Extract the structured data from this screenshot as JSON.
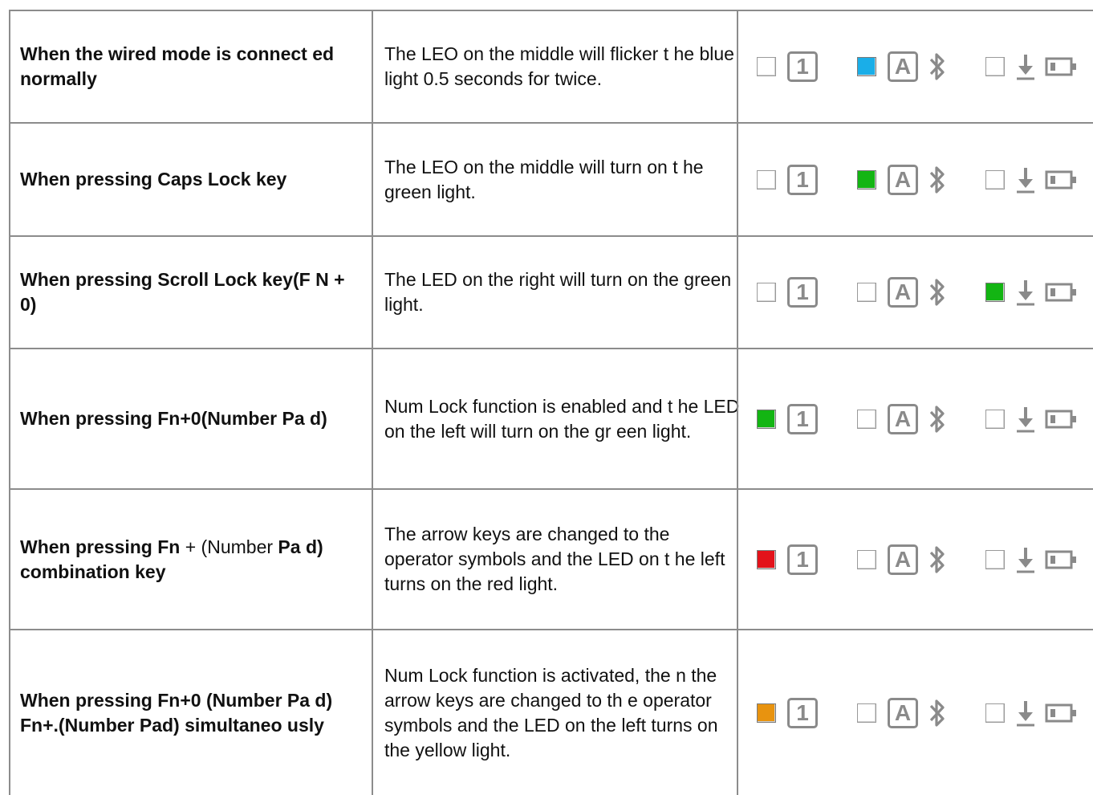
{
  "rows": [
    {
      "condition": "When the wired mode is connect ed normally",
      "description": "The LEO on the middle will flicker t he blue light 0.5 seconds for twice.",
      "leds": {
        "left": "off",
        "middle": "blue",
        "right": "off"
      }
    },
    {
      "condition": "When pressing Caps Lock key",
      "description": "The LEO on the middle will turn on t he green light.",
      "leds": {
        "left": "off",
        "middle": "green",
        "right": "off"
      }
    },
    {
      "condition": "When pressing Scroll Lock key(F N + 0)",
      "description": "The LED on the right will turn on the green light.",
      "leds": {
        "left": "off",
        "middle": "off",
        "right": "green"
      }
    },
    {
      "condition": "When pressing Fn+0(Number Pa d)",
      "description": "Num Lock function is enabled and t he LED on the left will turn on the gr een light.",
      "leds": {
        "left": "green",
        "middle": "off",
        "right": "off"
      }
    },
    {
      "condition_parts": [
        "When pressing Fn ",
        "+ (Number ",
        "Pa d) combination key"
      ],
      "condition": "When pressing Fn + (Number Pa d) combination key",
      "description": "The arrow keys are changed to the operator symbols and the LED on t he left turns on the red light.",
      "leds": {
        "left": "red",
        "middle": "off",
        "right": "off"
      }
    },
    {
      "condition": "When pressing Fn+0 (Number Pa d) Fn+.(Number Pad) simultaneo usly",
      "description": "Num Lock function is activated, the n the arrow keys are changed to th e operator symbols and the LED on the left turns on the yellow light.",
      "leds": {
        "left": "orange",
        "middle": "off",
        "right": "off"
      }
    }
  ],
  "icons": {
    "num_lock": "1",
    "caps_lock": "A",
    "bluetooth": "bluetooth-icon",
    "download": "download-icon",
    "battery": "battery-icon"
  },
  "colors": {
    "blue": "#1aaee8",
    "green": "#13b513",
    "red": "#e3121a",
    "orange": "#e8930f",
    "off": "#ffffff",
    "border": "#8c8c8c"
  }
}
